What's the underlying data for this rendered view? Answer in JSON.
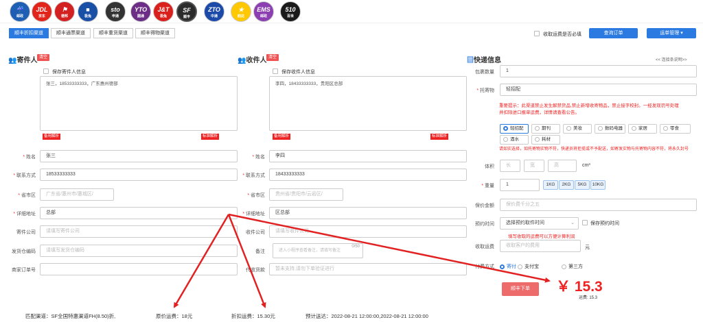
{
  "carriers": [
    {
      "top": "☔",
      "bottom": "邮政",
      "color": "#1e5fb4"
    },
    {
      "top": "JDL",
      "bottom": "京东",
      "color": "#e1251b"
    },
    {
      "top": "⚑",
      "bottom": "德邦",
      "color": "#d32020"
    },
    {
      "top": "■",
      "bottom": "极兔",
      "color": "#1a4fa6"
    },
    {
      "top": "sto",
      "bottom": "申通",
      "color": "#333"
    },
    {
      "top": "YTO",
      "bottom": "圆通",
      "color": "#6b2d86"
    },
    {
      "top": "J&T",
      "bottom": "极兔",
      "color": "#d9201c"
    },
    {
      "top": "SF",
      "bottom": "顺丰",
      "color": "#2b2b2b"
    },
    {
      "top": "ZTO",
      "bottom": "中通",
      "color": "#1c4aa8"
    },
    {
      "top": "★",
      "bottom": "韵达",
      "color": "#ffc800"
    },
    {
      "top": "EMS",
      "bottom": "邮政",
      "color": "#8c3fb1"
    },
    {
      "top": "510",
      "bottom": "百世",
      "color": "#1a1a1a"
    }
  ],
  "tabs": [
    "顺丰折扣渠道",
    "顺丰通票渠道",
    "顺丰重货渠道",
    "顺丰得物渠道"
  ],
  "toolbar": {
    "required_fee_label": "收取运费是否必填",
    "query_btn": "查询订单",
    "manage_btn": "运单管理 ▾"
  },
  "sender": {
    "title": "寄件人",
    "clear": "清空",
    "save_label": "保存寄件人信息",
    "paste": "张三，18533333333，广东惠州德部",
    "parse_alt": "备用解析",
    "parse_std": "标准解析",
    "name_label": "姓名",
    "name": "张三",
    "phone_label": "联系方式",
    "phone": "18533333333",
    "region_label": "省市区",
    "region": "广东省/惠州市/惠城区/",
    "addr_label": "详细地址",
    "addr": "总部",
    "company_label": "寄件公司",
    "company_ph": "请填写寄件公司",
    "warehouse_label": "发货仓编码",
    "warehouse_ph": "请填写发货仓编码",
    "order_label": "商家订单号"
  },
  "recipient": {
    "title": "收件人",
    "clear": "清空",
    "save_label": "保存收件人信息",
    "paste": "李四，18433333333，贵阳区总部",
    "parse_alt": "备用解析",
    "parse_std": "标准解析",
    "name_label": "姓名",
    "name": "李四",
    "phone_label": "联系方式",
    "phone": "18433333333",
    "region_label": "省市区",
    "region": "贵州省/贵阳市/云岩区/",
    "addr_label": "详细地址",
    "addr": "区总部",
    "company_label": "收件公司",
    "company_ph": "请填写收件公司",
    "remark_label": "备注",
    "remark_ph": "进入小程序查看备注，请填写备注",
    "remark_count": "0/50",
    "collect_label": "代收货款",
    "collect_ph": "暂未支持,请勿下单验证进行"
  },
  "express": {
    "title": "快递信息",
    "help": "<< 连接条说明>>",
    "pkg_label": "包裹数量",
    "pkg": "1",
    "goods_label": "托寄物",
    "goods": "轻招配",
    "notice": "重要提示：此渠道禁止发生解禁货品,禁止新增收寄物品，禁止接字校封。一经发现罚号处理",
    "notice2": "并扣除进口报单运费，详情请查看公告。",
    "cats": [
      "轻招配",
      "期刊",
      "美妆",
      "数码电器",
      "家居",
      "零食",
      "酒水",
      "耗材"
    ],
    "cat_warn": "请如实选择，如托寄物实物不符，快递员将拒揽或不予配送，如寄发实物与托寄物内容不符，将永久封号",
    "vol_label": "体积",
    "vol_l": "长",
    "vol_w": "宽",
    "vol_h": "高",
    "vol_unit": "cm³",
    "weight_label": "重量",
    "weight": "1",
    "weights": [
      "1KG",
      "2KG",
      "5KG",
      "10KG"
    ],
    "insure_label": "保价金额",
    "insure_ph": "保价费千分之五",
    "time_label": "预约时间",
    "time": "选择预约取件时间",
    "save_time": "保存预约时间",
    "fee_warn": "填写收取的运费可以方便计算利润",
    "fee_label": "收取运费",
    "fee_ph": "收取客户的费用",
    "fee_unit": "元",
    "pay_label": "付费方式",
    "pay": [
      "寄付",
      "支付宝",
      "第三方"
    ],
    "submit": "顺丰下单",
    "price": "￥ 15.3",
    "price_sub": "运费: 15.3"
  },
  "footer": {
    "channel": "匹配渠道：SF全国特惠渠道FH(8.50)折,",
    "orig": "原价运费：18元",
    "disc": "折扣运费：15.30元",
    "eta": "预计送达：2022-08-21 12:00:00,2022-08-21 12:00:00"
  },
  "colors": {
    "accent": "#2a7ae2",
    "danger": "#e22222"
  }
}
